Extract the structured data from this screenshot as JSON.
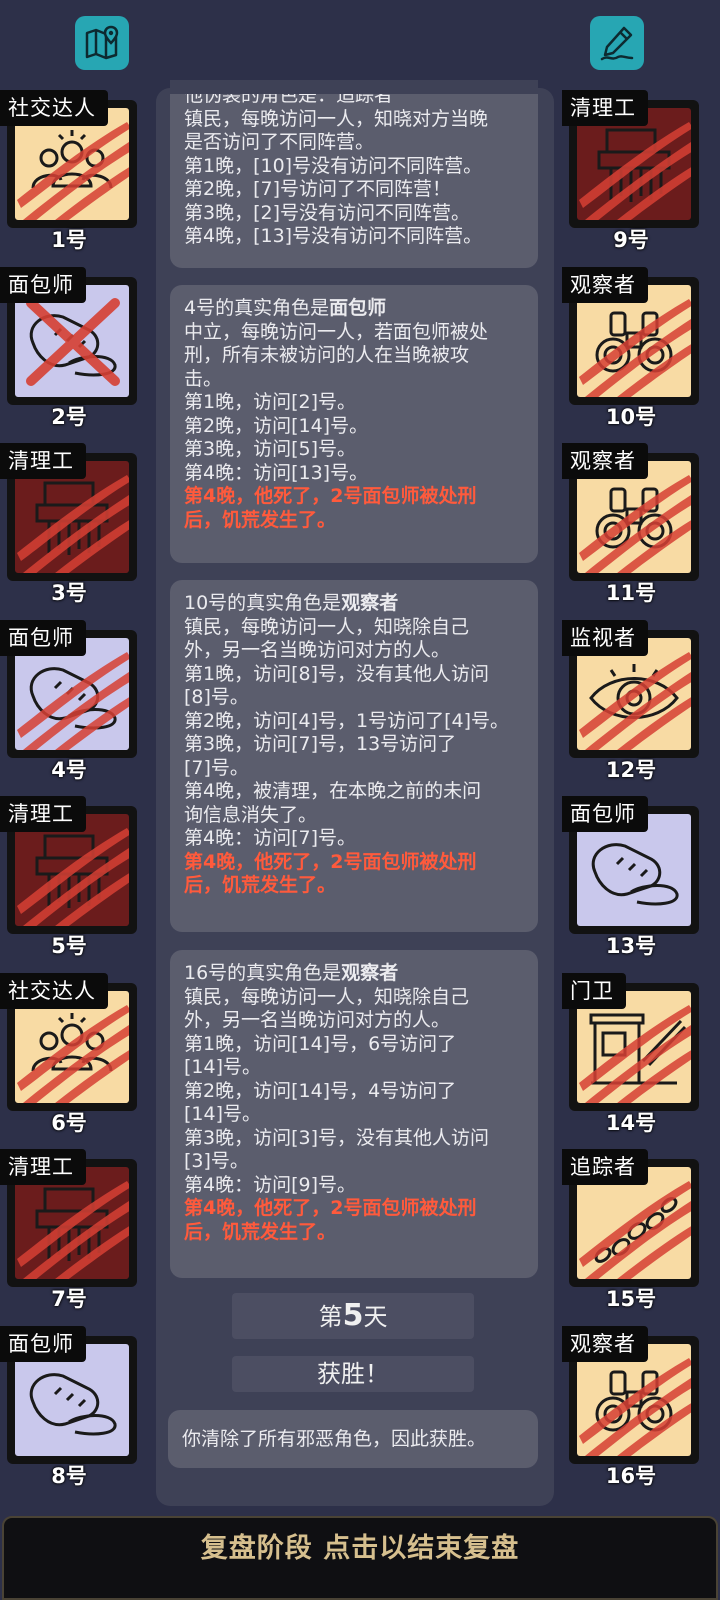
{
  "top": {
    "left_icon": "map-pin-icon",
    "right_icon": "notebook-pen-icon"
  },
  "players_left": [
    {
      "role": "社交达人",
      "num": "1号",
      "bg": "peach",
      "icon": "crowd",
      "mark": "claw"
    },
    {
      "role": "面包师",
      "num": "2号",
      "bg": "lav",
      "icon": "bread",
      "mark": "cross"
    },
    {
      "role": "清理工",
      "num": "3号",
      "bg": "dark",
      "icon": "shredder",
      "mark": "claw"
    },
    {
      "role": "面包师",
      "num": "4号",
      "bg": "lav",
      "icon": "bread",
      "mark": "claw"
    },
    {
      "role": "清理工",
      "num": "5号",
      "bg": "dark",
      "icon": "shredder",
      "mark": "claw"
    },
    {
      "role": "社交达人",
      "num": "6号",
      "bg": "peach",
      "icon": "crowd",
      "mark": "claw"
    },
    {
      "role": "清理工",
      "num": "7号",
      "bg": "dark",
      "icon": "shredder",
      "mark": "claw"
    },
    {
      "role": "面包师",
      "num": "8号",
      "bg": "lav",
      "icon": "bread",
      "mark": "none"
    }
  ],
  "players_right": [
    {
      "role": "清理工",
      "num": "9号",
      "bg": "dark",
      "icon": "shredder",
      "mark": "claw"
    },
    {
      "role": "观察者",
      "num": "10号",
      "bg": "peach",
      "icon": "binoculars",
      "mark": "claw"
    },
    {
      "role": "观察者",
      "num": "11号",
      "bg": "peach",
      "icon": "binoculars",
      "mark": "claw"
    },
    {
      "role": "监视者",
      "num": "12号",
      "bg": "peach",
      "icon": "eye",
      "mark": "claw"
    },
    {
      "role": "面包师",
      "num": "13号",
      "bg": "lav",
      "icon": "bread",
      "mark": "none"
    },
    {
      "role": "门卫",
      "num": "14号",
      "bg": "peach",
      "icon": "booth",
      "mark": "claw"
    },
    {
      "role": "追踪者",
      "num": "15号",
      "bg": "peach",
      "icon": "footprints",
      "mark": "claw"
    },
    {
      "role": "观察者",
      "num": "16号",
      "bg": "peach",
      "icon": "binoculars",
      "mark": "claw"
    }
  ],
  "messages": [
    {
      "title": "他伪装的角色是：追踪者",
      "lines": [
        "镇民，每晚访问一人，知晓对方当晚",
        "是否访问了不同阵营。",
        "第1晚，[10]号没有访问不同阵营。",
        "第2晚，[7]号访问了不同阵营！",
        "第3晚，[2]号没有访问不同阵营。",
        "第4晚，[13]号没有访问不同阵营。"
      ],
      "red": []
    },
    {
      "title": "4号的真实角色是面包师",
      "lines": [
        "中立，每晚访问一人，若面包师被处",
        "刑，所有未被访问的人在当晚被攻",
        "击。",
        "第1晚，访问[2]号。",
        "第2晚，访问[14]号。",
        "第3晚，访问[5]号。",
        "第4晚：访问[13]号。"
      ],
      "red": [
        "第4晚，他死了，2号面包师被处刑",
        "后，饥荒发生了。"
      ]
    },
    {
      "title": "10号的真实角色是观察者",
      "lines": [
        "镇民，每晚访问一人，知晓除自己",
        "外，另一名当晚访问对方的人。",
        "第1晚，访问[8]号，没有其他人访问",
        "[8]号。",
        "第2晚，访问[4]号，1号访问了[4]号。",
        "第3晚，访问[7]号，13号访问了",
        "[7]号。",
        "第4晚，被清理，在本晚之前的未问",
        "询信息消失了。",
        "第4晚：访问[7]号。"
      ],
      "red": [
        "第4晚，他死了，2号面包师被处刑",
        "后，饥荒发生了。"
      ]
    },
    {
      "title": "16号的真实角色是观察者",
      "lines": [
        "镇民，每晚访问一人，知晓除自己",
        "外，另一名当晚访问对方的人。",
        "第1晚，访问[14]号，6号访问了",
        "[14]号。",
        "第2晚，访问[14]号，4号访问了",
        "[14]号。",
        "第3晚，访问[3]号，没有其他人访问",
        "[3]号。",
        "第4晚：访问[9]号。"
      ],
      "red": [
        "第4晚，他死了，2号面包师被处刑",
        "后，饥荒发生了。"
      ]
    }
  ],
  "day": {
    "prefix": "第",
    "number": "5",
    "suffix": "天"
  },
  "result": "获胜！",
  "final_message": "你清除了所有邪恶角色，因此获胜。",
  "bottom_bar": "复盘阶段 点击以结束复盘",
  "colors": {
    "background": "#2d3049",
    "accent_teal": "#27a6b3",
    "red_text": "#ff5a3c",
    "bottom_text": "#d6bf8e"
  }
}
